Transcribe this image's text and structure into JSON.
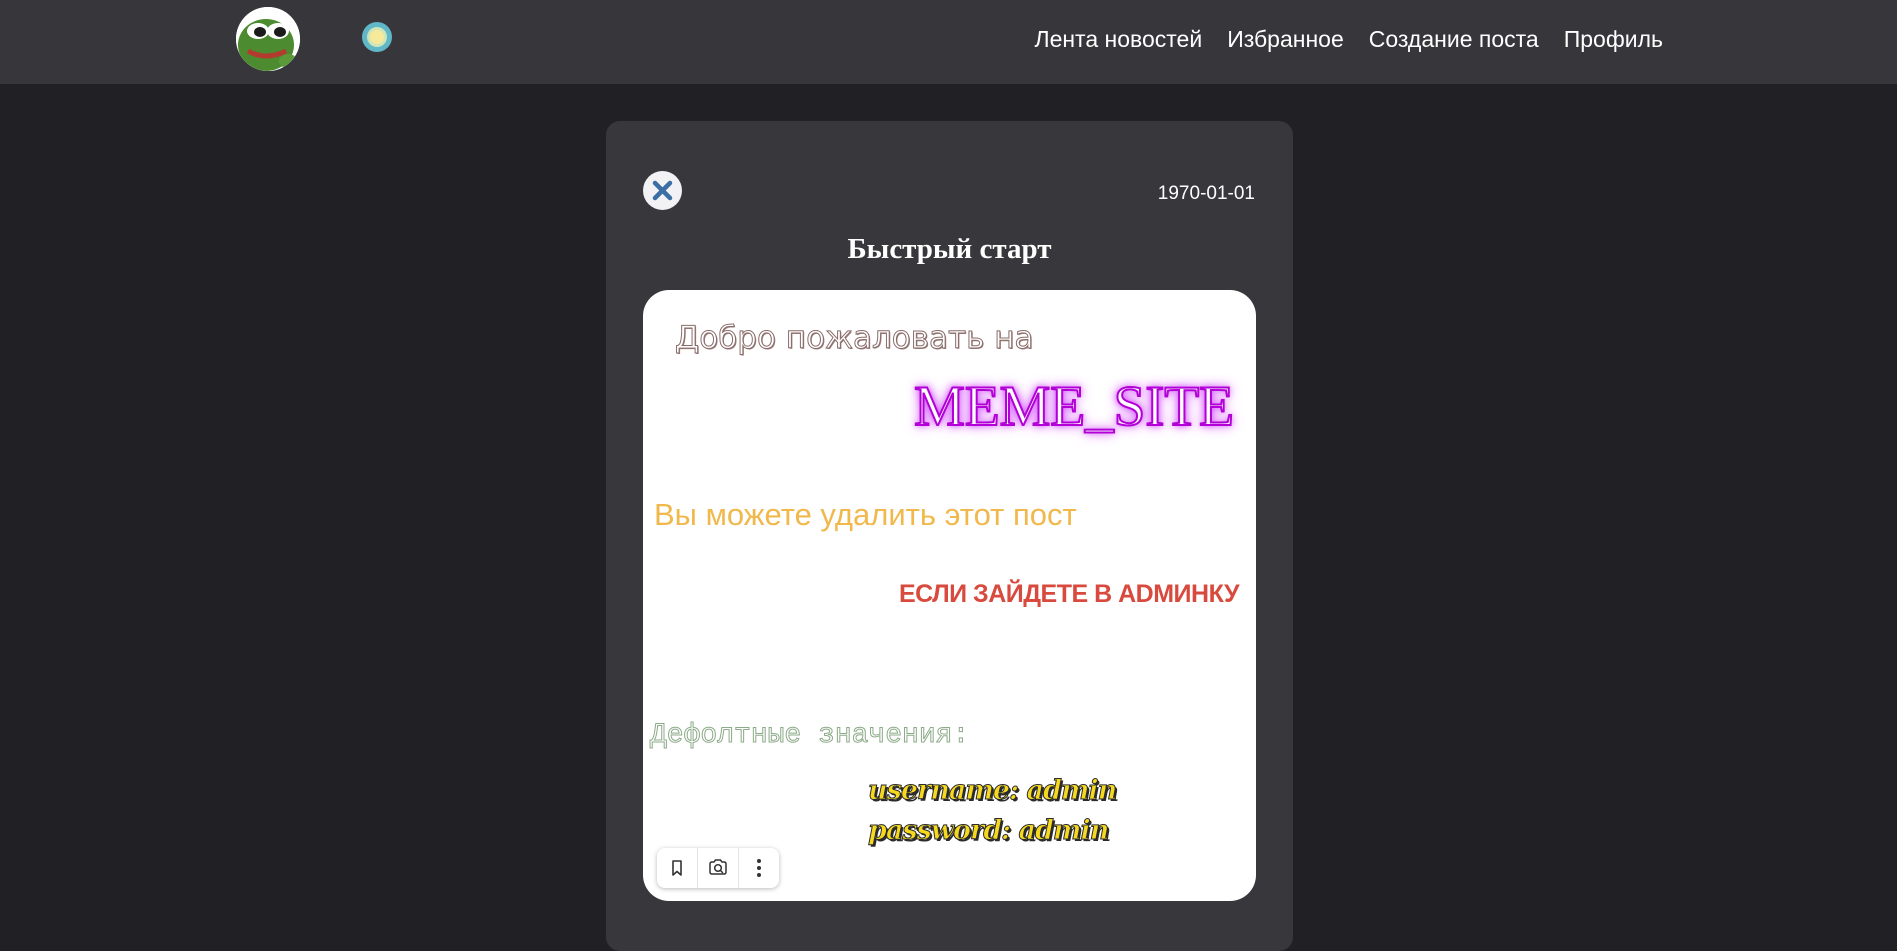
{
  "nav": {
    "logo_icon": "pepe-frog-avatar",
    "theme_icon": "sun-icon",
    "links": [
      "Лента новостей",
      "Избранное",
      "Создание поста",
      "Профиль"
    ]
  },
  "post": {
    "date": "1970-01-01",
    "title": "Быстрый старт",
    "close_icon": "close-icon",
    "image_text": {
      "line1": "Добро пожаловать на",
      "brand": "MEME_SITE",
      "line2": "Вы можете удалить этот пост",
      "line3": "ЕСЛИ ЗАЙДЕТЕ В ADMИНКУ",
      "line4": "Дефолтные значения:",
      "username": "username: admin",
      "password": "password: admin"
    },
    "toolbar_icons": [
      "bookmark-icon",
      "camera-search-icon",
      "more-vertical-icon"
    ]
  },
  "colors": {
    "page_bg": "#212125",
    "navbar_bg": "#37373b",
    "card_bg": "#38383c",
    "close_x": "#3a6ea5",
    "brand_glow": "#c100ff",
    "line2": "#f1b84c",
    "line3": "#d84a3d",
    "credentials": "#f6d91e"
  }
}
